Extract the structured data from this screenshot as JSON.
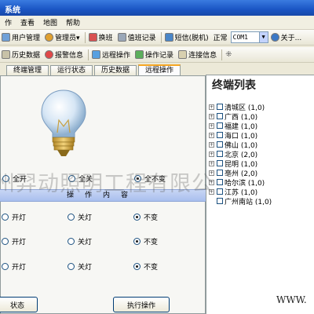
{
  "window": {
    "title": "系统"
  },
  "menubar": [
    "作",
    "查看",
    "地图",
    "帮助"
  ],
  "toolbar1": {
    "items": [
      {
        "label": "用户管理",
        "icon": "users-icon"
      },
      {
        "label": "管理员▾",
        "icon": "admin-icon"
      },
      {
        "label": "换班",
        "icon": "swap-icon"
      },
      {
        "label": "值班记录",
        "icon": "log-icon"
      },
      {
        "label": "短信(脱机)",
        "icon": "sms-icon"
      },
      {
        "label": "关于...",
        "icon": "info-icon"
      }
    ],
    "status": "正常",
    "com_port": "COM1"
  },
  "toolbar2": {
    "items": [
      {
        "label": "历史数据",
        "icon": "history-icon"
      },
      {
        "label": "报警信息",
        "icon": "alarm-icon"
      },
      {
        "label": "远程操作",
        "icon": "remote-icon"
      },
      {
        "label": "操作记录",
        "icon": "record-icon"
      },
      {
        "label": "连接信息",
        "icon": "link-icon"
      }
    ]
  },
  "tabs": [
    "终端管理",
    "运行状态",
    "历史数据",
    "远程操作"
  ],
  "active_tab": "远程操作",
  "main": {
    "all_options": [
      "全开",
      "全关",
      "全不变"
    ],
    "all_selected": "全不变",
    "op_header": "操作内容",
    "rows": [
      {
        "options": [
          "开灯",
          "关灯",
          "不变"
        ],
        "selected": "不变"
      },
      {
        "options": [
          "开灯",
          "关灯",
          "不变"
        ],
        "selected": "不变"
      },
      {
        "options": [
          "开灯",
          "关灯",
          "不变"
        ],
        "selected": "不变"
      }
    ],
    "buttons": {
      "status": "状态",
      "execute": "执行操作"
    }
  },
  "terminal_list": {
    "title": "终端列表",
    "items": [
      "清城区 (1,0)",
      "广西 (1,0)",
      "福建 (1,0)",
      "海口 (1,0)",
      "佛山 (1,0)",
      "北京 (2,0)",
      "昆明 (1,0)",
      "亳州 (2,0)",
      "哈尔滨 (1,0)",
      "江苏 (1,0)",
      "广州南站 (1,0)"
    ]
  },
  "watermark": "州羿动照明工程有限公",
  "url_text": "WWW."
}
